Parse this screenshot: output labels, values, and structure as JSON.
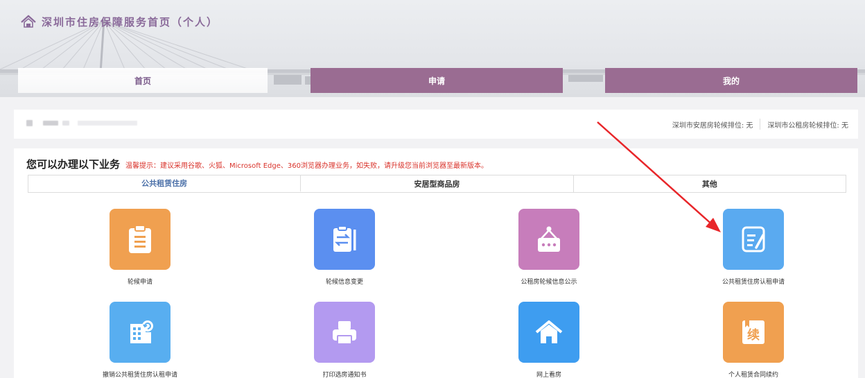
{
  "header": {
    "title": "深圳市住房保障服务首页（个人）",
    "brand_color": "#8a6a9a"
  },
  "nav": {
    "tabs": [
      {
        "label": "首页",
        "active": true
      },
      {
        "label": "申请",
        "active": false
      },
      {
        "label": "我的",
        "active": false
      }
    ],
    "tab_color": "#9a6c92"
  },
  "userbar": {
    "anju_queue": "深圳市安居房轮候排位: 无",
    "gongzu_queue": "深圳市公租房轮候排位: 无"
  },
  "panel": {
    "title": "您可以办理以下业务",
    "tip": "温馨提示：建议采用谷歌、火狐、Microsoft Edge、360浏览器办理业务，如失败，请升级您当前浏览器至最新版本。",
    "categories": [
      {
        "label": "公共租赁住房",
        "active": true
      },
      {
        "label": "安居型商品房",
        "active": false
      },
      {
        "label": "其他",
        "active": false
      }
    ],
    "services": [
      {
        "label": "轮候申请",
        "icon": "clipboard-icon",
        "color": "#f0a050"
      },
      {
        "label": "轮候信息变更",
        "icon": "exchange-document-icon",
        "color": "#5b8ff0"
      },
      {
        "label": "公租房轮候信息公示",
        "icon": "notice-board-icon",
        "color": "#c77dbb"
      },
      {
        "label": "公共租赁住房认租申请",
        "icon": "edit-document-icon",
        "color": "#5aaaf0"
      },
      {
        "label": "撤销公共租赁住房认租申请",
        "icon": "building-undo-icon",
        "color": "#58aef0"
      },
      {
        "label": "打印选房通知书",
        "icon": "printer-icon",
        "color": "#b39af0"
      },
      {
        "label": "网上看房",
        "icon": "home-icon",
        "color": "#3e9df0"
      },
      {
        "label": "个人租赁合同续约",
        "icon": "renew-contract-icon",
        "color": "#f0a050",
        "icon_text": "续"
      }
    ]
  }
}
